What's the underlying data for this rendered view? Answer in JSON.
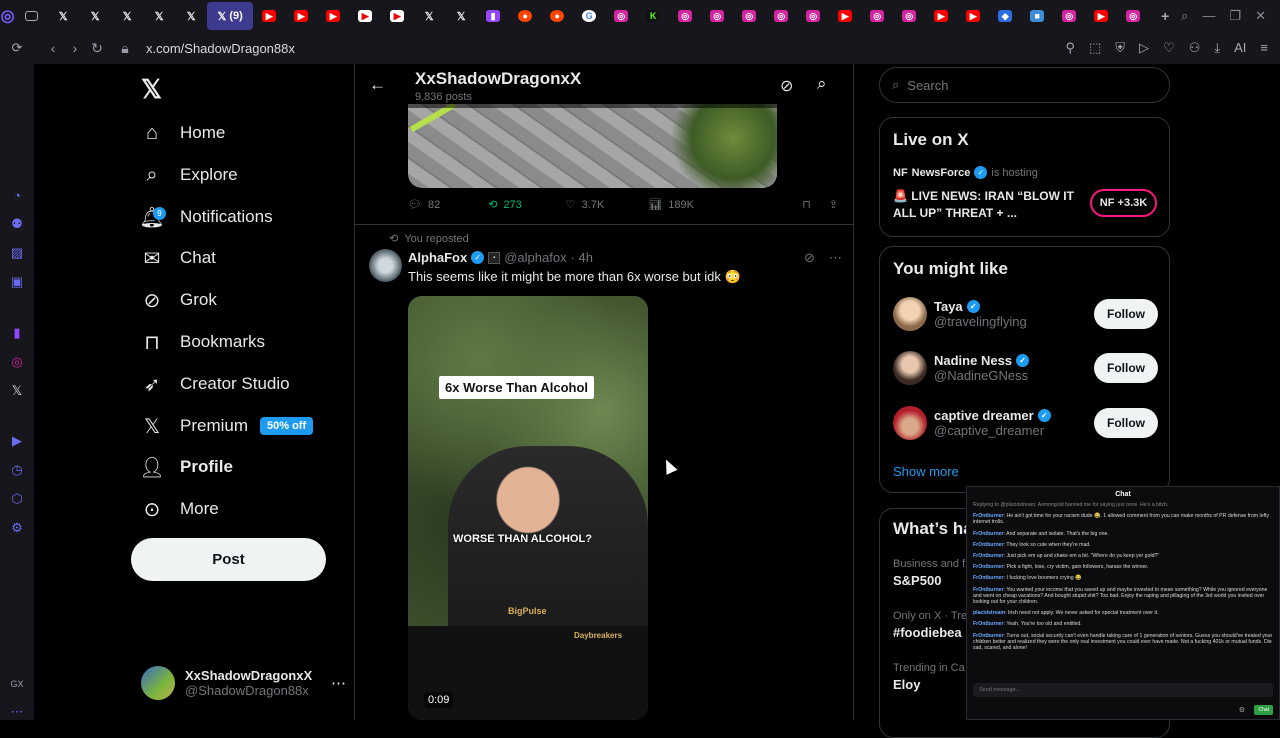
{
  "browser": {
    "active_tab_label": "(9)",
    "url": "x.com/ShadowDragon88x",
    "ai_label": "AI"
  },
  "nav": {
    "items": [
      {
        "label": "Home",
        "icon": "home-icon"
      },
      {
        "label": "Explore",
        "icon": "search-icon"
      },
      {
        "label": "Notifications",
        "icon": "bell-icon",
        "badge": "9"
      },
      {
        "label": "Chat",
        "icon": "mail-icon"
      },
      {
        "label": "Grok",
        "icon": "grok-icon"
      },
      {
        "label": "Bookmarks",
        "icon": "bookmark-icon"
      },
      {
        "label": "Creator Studio",
        "icon": "rocket-icon"
      },
      {
        "label": "Premium",
        "icon": "x-logo-icon",
        "badge": "50% off"
      },
      {
        "label": "Profile",
        "icon": "person-icon"
      },
      {
        "label": "More",
        "icon": "more-circle-icon"
      }
    ],
    "post_button": "Post",
    "account": {
      "name": "XxShadowDragonxX",
      "handle": "@ShadowDragon88x"
    }
  },
  "profile_header": {
    "title": "XxShadowDragonxX",
    "posts_count": "9,836 posts"
  },
  "prev_post_actions": {
    "replies": "82",
    "reposts": "273",
    "likes": "3.7K",
    "views": "189K"
  },
  "post": {
    "repost_note": "You reposted",
    "name": "AlphaFox",
    "handle": "@alphafox",
    "time": "· 4h",
    "text": "This seems like it might be more than 6x worse but idk 😳",
    "video_caption_top": "6x Worse Than Alcohol",
    "video_caption_mid": "WORSE THAN ALCOHOL?",
    "watermark_1": "BigPulse",
    "watermark_2": "Daybreakers",
    "duration": "0:09"
  },
  "right": {
    "search_placeholder": "Search",
    "live": {
      "heading": "Live on X",
      "host": "NewsForce",
      "hosting_text": "is hosting",
      "title": "🚨 LIVE NEWS: IRAN “BLOW IT ALL UP” THREAT + ...",
      "listeners": "+3.3K"
    },
    "suggest": {
      "heading": "You might like",
      "people": [
        {
          "name": "Taya",
          "handle": "@travelingflying",
          "button": "Follow"
        },
        {
          "name": "Nadine Ness",
          "handle": "@NadineGNess",
          "button": "Follow"
        },
        {
          "name": "captive dreamer",
          "handle": "@captive_dreamer",
          "button": "Follow"
        }
      ],
      "show_more": "Show more"
    },
    "trends": {
      "heading": "What’s ha",
      "items": [
        {
          "context": "Business and f",
          "name": "S&P500"
        },
        {
          "context": "Only on X · Tre",
          "name": "#foodiebea"
        },
        {
          "context": "Trending in Ca",
          "name": "Eloy"
        }
      ]
    }
  },
  "chat": {
    "title": "Chat",
    "reply_note": "Replying to @placidstream: Asmongold banned me for saying just once. He's a bitch.",
    "messages": [
      {
        "user": "FrOntburner",
        "text": "He ain't got time for your racism dude 😂. 1 allowed comment from you can make months of PR defense from lefty internet trolls."
      },
      {
        "user": "FrOntburner",
        "text": "And separate and isolate. That's the big one."
      },
      {
        "user": "FrOntburner",
        "text": "They look so cute when they're mad."
      },
      {
        "user": "FrOntburner",
        "text": "Just pick em up and shake em a bit. \"Where do ya keep yer gold?\""
      },
      {
        "user": "FrOntburner",
        "text": "Pick a fight, lose, cry victim, gain followers, harass the winner."
      },
      {
        "user": "FrOntburner",
        "text": "I fucking love boomers crying 😂"
      },
      {
        "user": "FrOntburner",
        "text": "You wanted your income that you saved up and maybe invested to mean something? While you ignored everyone and went on cheap vacations? And bought stupid shit? Too bad. Enjoy the raping and pillaging of the 3rd world you invited over looking out for your children."
      },
      {
        "user": "placidstream",
        "text": "Irish need not apply. We never asked for special treatment over it."
      },
      {
        "user": "FrOntburner",
        "text": "Yeah. You're too old and entitled."
      },
      {
        "user": "FrOntburner",
        "text": "Turns out, social security can't even handle taking care of 1 generation of seniors. Guess you should've treated your children better and realized they were the only real investment you could ever have made. Not a fucking 401k or mutual funds. Die sad, scared, and alone!"
      }
    ],
    "input_placeholder": "Send message...",
    "send_label": "Chat"
  }
}
